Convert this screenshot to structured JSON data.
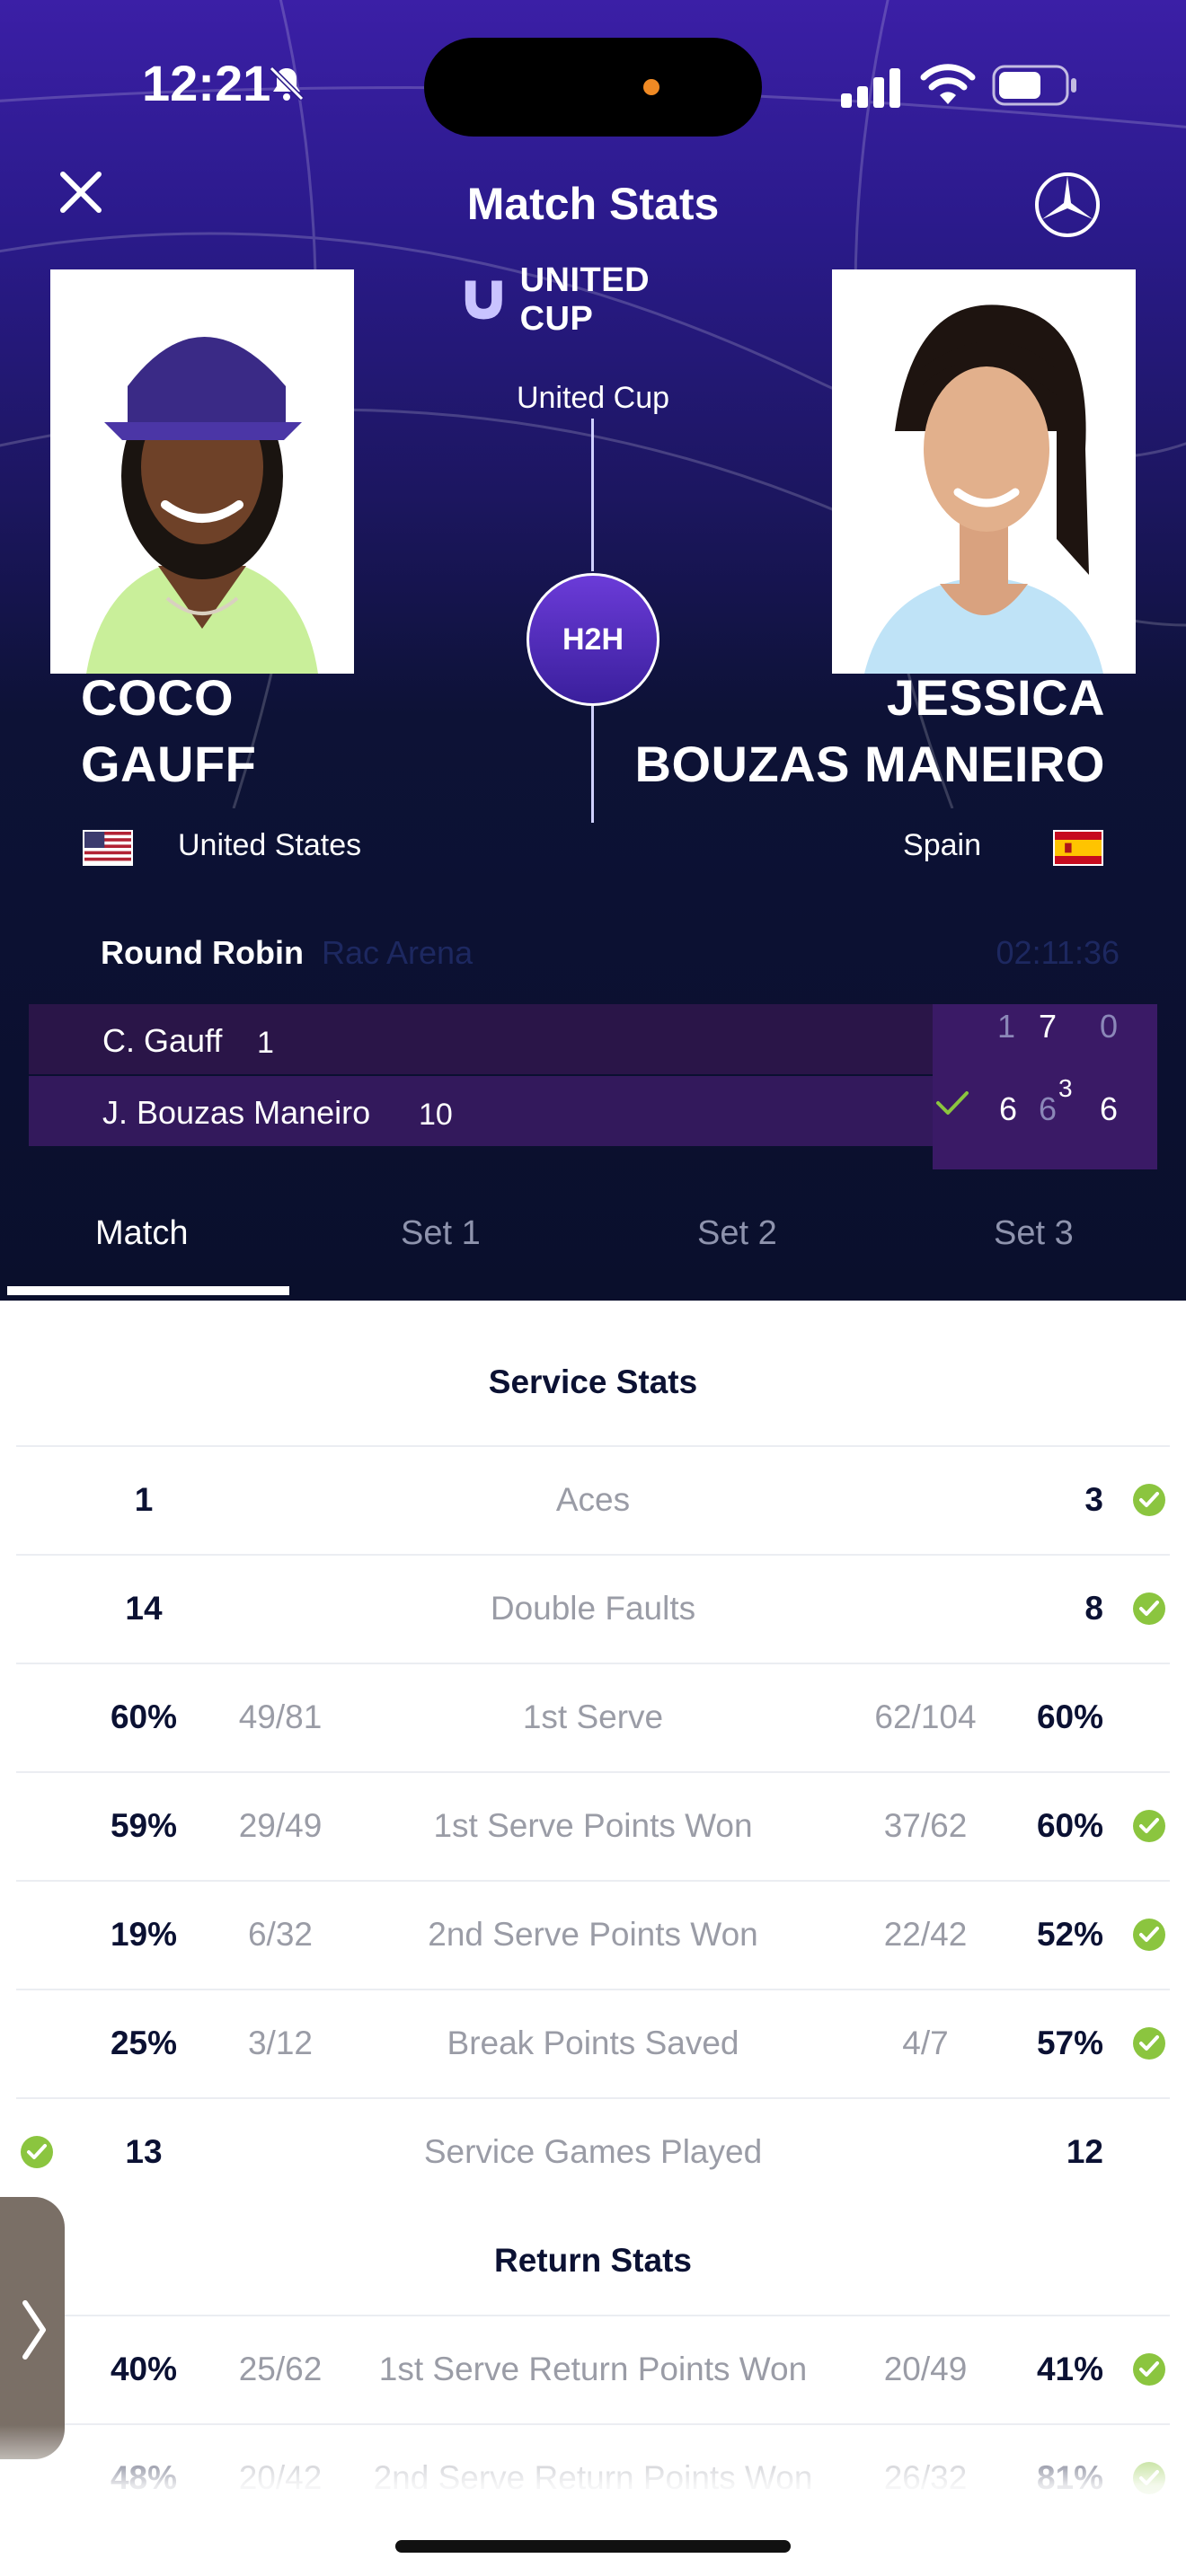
{
  "status_bar": {
    "time": "12:21",
    "icons": [
      "bell-slash-icon",
      "signal-icon",
      "wifi-icon",
      "battery-icon"
    ]
  },
  "header": {
    "title": "Match Stats",
    "brand": "UNITED CUP",
    "event": "United Cup",
    "h2h_label": "H2H",
    "colors": {
      "accent": "#6b3bd8",
      "background": "#0a0f2c",
      "winner_check": "#8bc53f"
    }
  },
  "players": {
    "left": {
      "first": "COCO",
      "last": "GAUFF",
      "country": "United States"
    },
    "right": {
      "first": "JESSICA",
      "last": "BOUZAS MANEIRO",
      "country": "Spain"
    }
  },
  "match_info": {
    "round": "Round Robin",
    "venue": "Rac Arena",
    "duration": "02:11:36"
  },
  "scoreboard": {
    "rows": [
      {
        "name": "C. Gauff",
        "seed": "1",
        "sets": [
          "1",
          "7",
          "0"
        ],
        "tiebreak": ""
      },
      {
        "name": "J. Bouzas Maneiro",
        "seed": "10",
        "sets": [
          "6",
          "6",
          "6"
        ],
        "tiebreak": "3"
      }
    ]
  },
  "tabs": [
    {
      "label": "Match",
      "active": true
    },
    {
      "label": "Set 1",
      "active": false
    },
    {
      "label": "Set 2",
      "active": false
    },
    {
      "label": "Set 3",
      "active": false
    }
  ],
  "service_stats": {
    "title": "Service Stats",
    "rows": [
      {
        "label": "Aces",
        "left": "1",
        "left_detail": "",
        "right": "3",
        "right_detail": "",
        "winner": "right"
      },
      {
        "label": "Double Faults",
        "left": "14",
        "left_detail": "",
        "right": "8",
        "right_detail": "",
        "winner": "right"
      },
      {
        "label": "1st Serve",
        "left": "60%",
        "left_detail": "49/81",
        "right": "60%",
        "right_detail": "62/104",
        "winner": "none"
      },
      {
        "label": "1st Serve Points Won",
        "left": "59%",
        "left_detail": "29/49",
        "right": "60%",
        "right_detail": "37/62",
        "winner": "right"
      },
      {
        "label": "2nd Serve Points Won",
        "left": "19%",
        "left_detail": "6/32",
        "right": "52%",
        "right_detail": "22/42",
        "winner": "right"
      },
      {
        "label": "Break Points Saved",
        "left": "25%",
        "left_detail": "3/12",
        "right": "57%",
        "right_detail": "4/7",
        "winner": "right"
      },
      {
        "label": "Service Games Played",
        "left": "13",
        "left_detail": "",
        "right": "12",
        "right_detail": "",
        "winner": "left"
      }
    ]
  },
  "return_stats": {
    "title": "Return Stats",
    "rows": [
      {
        "label": "1st Serve Return Points Won",
        "left": "40%",
        "left_detail": "25/62",
        "right": "41%",
        "right_detail": "20/49",
        "winner": "right"
      },
      {
        "label": "2nd Serve Return Points Won",
        "left": "48%",
        "left_detail": "20/42",
        "right": "81%",
        "right_detail": "26/32",
        "winner": "right"
      }
    ]
  }
}
